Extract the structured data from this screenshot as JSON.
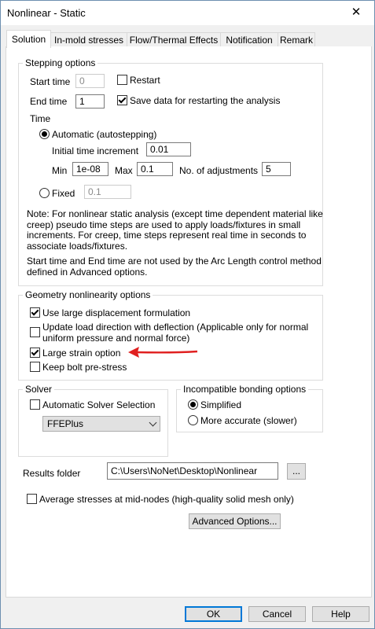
{
  "window": {
    "title": "Nonlinear - Static",
    "close_glyph": "✕"
  },
  "tabs": [
    "Solution",
    "In-mold stresses",
    "Flow/Thermal Effects",
    "Notification",
    "Remark"
  ],
  "stepping": {
    "legend": "Stepping options",
    "start_time_label": "Start time",
    "start_time_value": "0",
    "restart_label": "Restart",
    "end_time_label": "End time",
    "end_time_value": "1",
    "save_data_label": "Save data for restarting the analysis",
    "time_label": "Time",
    "automatic_label": "Automatic (autostepping)",
    "initial_increment_label": "Initial time increment",
    "initial_increment_value": "0.01",
    "min_label": "Min",
    "min_value": "1e-08",
    "max_label": "Max",
    "max_value": "0.1",
    "adjustments_label": "No. of adjustments",
    "adjustments_value": "5",
    "fixed_label": "Fixed",
    "fixed_value": "0.1",
    "note_lines": [
      "Note: For nonlinear static analysis (except time dependent material like",
      "creep) pseudo time steps are used to apply loads/fixtures in small",
      "increments. For creep, time steps represent real time in seconds to",
      "associate loads/fixtures."
    ],
    "note2_lines": [
      "Start time and End time  are not used by the Arc Length control method",
      "defined in Advanced options."
    ]
  },
  "geometry": {
    "legend": "Geometry nonlinearity options",
    "large_displacement_label": "Use large displacement formulation",
    "update_load_lines": [
      "Update load direction with deflection (Applicable only for normal",
      "uniform pressure and normal force)"
    ],
    "large_strain_label": "Large strain option",
    "keep_bolt_label": "Keep bolt pre-stress"
  },
  "solver": {
    "legend": "Solver",
    "auto_label": "Automatic Solver Selection",
    "selected": "FFEPlus"
  },
  "bonding": {
    "legend": "Incompatible bonding options",
    "simplified_label": "Simplified",
    "accurate_label": "More accurate (slower)"
  },
  "results": {
    "label": "Results folder",
    "path": "C:\\Users\\NoNet\\Desktop\\Nonlinear",
    "browse_label": "..."
  },
  "average_label": "Average stresses at mid-nodes (high-quality solid mesh only)",
  "advanced_label": "Advanced Options...",
  "footer": {
    "ok": "OK",
    "cancel": "Cancel",
    "help": "Help"
  },
  "colors": {
    "annotation_arrow": "#e02020",
    "accent": "#0078d7"
  }
}
